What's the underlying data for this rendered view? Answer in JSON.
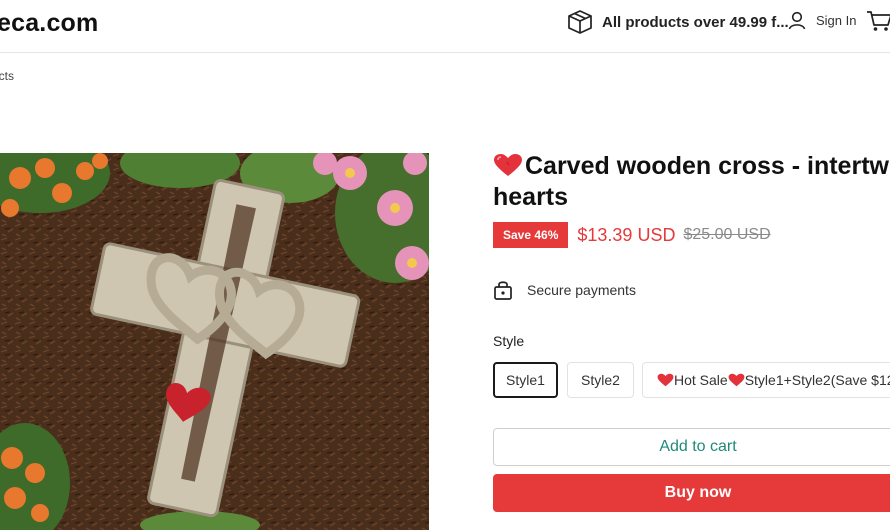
{
  "header": {
    "logo_text": "eca.com",
    "shipping_text": "All products over 49.99 f...",
    "signin_label": "Sign In"
  },
  "breadcrumb": "ucts",
  "product": {
    "title_line1": "Carved wooden cross - intertw",
    "title_line2": "hearts",
    "save_badge": "Save 46%",
    "price": "$13.39 USD",
    "compare_price": "$25.00 USD",
    "secure_text": "Secure payments",
    "style_label": "Style",
    "variants": [
      {
        "label": "Style1",
        "selected": true
      },
      {
        "label": "Style2",
        "selected": false
      },
      {
        "label_a": "Hot Sale",
        "label_b": "Style1+Style2(Save $12",
        "selected": false
      }
    ],
    "add_to_cart_label": "Add to cart",
    "buy_now_label": "Buy now"
  },
  "icons": {
    "shipping": "package-box-icon",
    "user": "user-icon",
    "cart": "shopping-cart-icon",
    "lock": "lock-icon",
    "heart": "heart-emoji-icon"
  },
  "colors": {
    "accent_red": "#e5393a",
    "add_to_cart_text": "#1f8a7a",
    "compare_price": "#8a8a8a"
  }
}
